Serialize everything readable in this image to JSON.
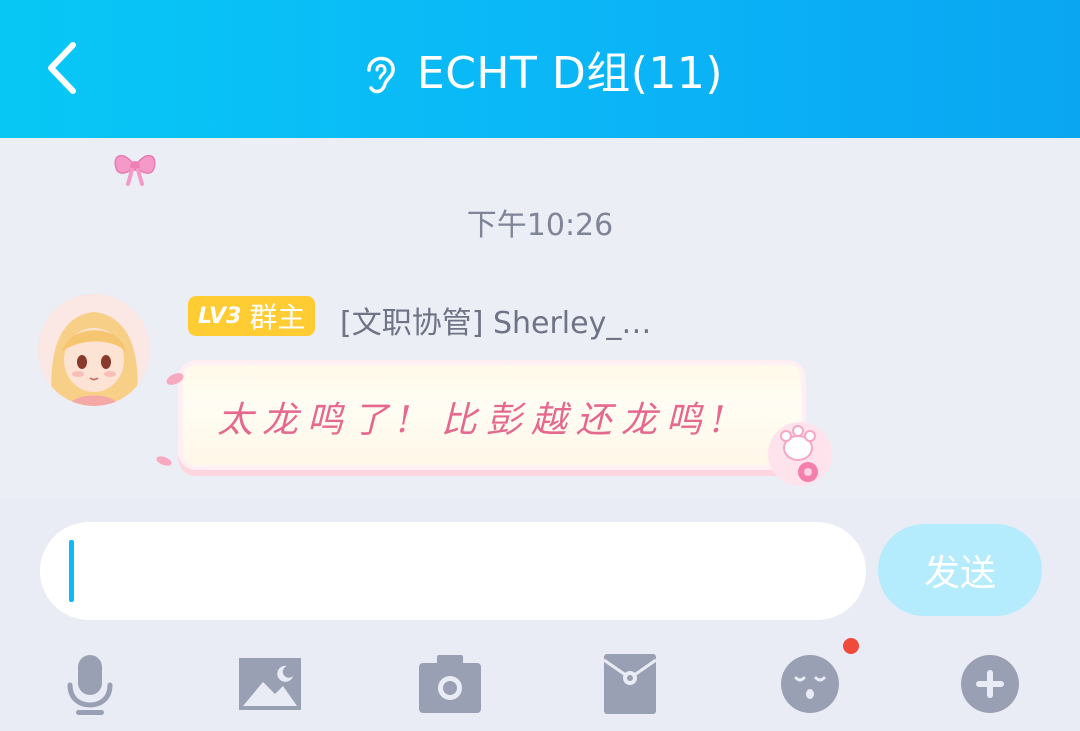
{
  "header": {
    "title": "ECHT D组(11)",
    "back_icon": "chevron-left-icon",
    "ear_icon": "ear-icon",
    "background": "#0bb7f7"
  },
  "chat": {
    "timestamp": "下午10:26",
    "message": {
      "level_badge": "LV3",
      "role_badge": "群主",
      "sender": "[文职协管] Sherley_…",
      "text": "太龙鸣了! 比彭越还龙鸣!",
      "avatar_icon": "avatar-image",
      "badge_color": "#ffcc33",
      "text_color": "#e5688f"
    }
  },
  "composer": {
    "input_value": "",
    "send_label": "发送",
    "send_color": "#b5ecfd",
    "caret_color": "#12b7f5"
  },
  "toolbar": {
    "items": [
      {
        "icon": "microphone-icon"
      },
      {
        "icon": "image-icon"
      },
      {
        "icon": "camera-icon"
      },
      {
        "icon": "red-packet-icon"
      },
      {
        "icon": "emoji-icon",
        "has_notification_dot": true
      },
      {
        "icon": "plus-icon"
      }
    ]
  }
}
